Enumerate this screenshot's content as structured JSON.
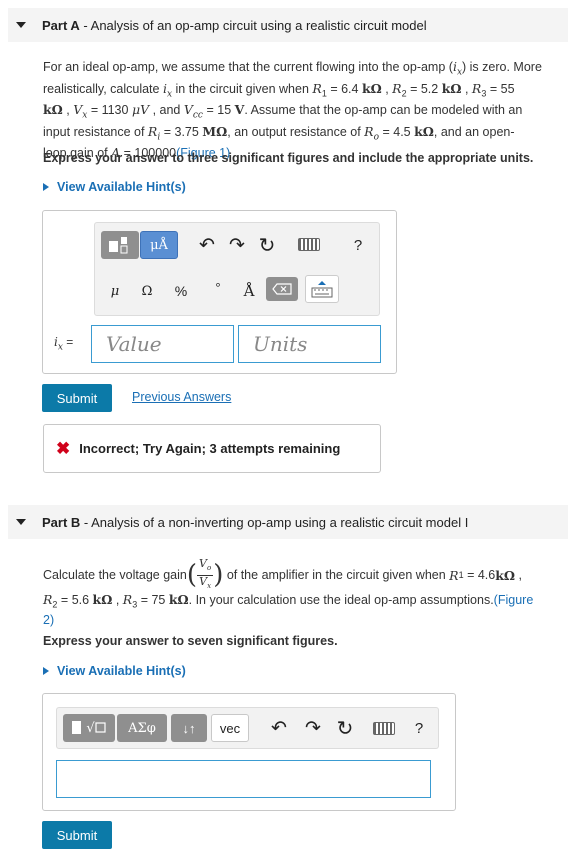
{
  "partA": {
    "label": "Part A",
    "title": " - Analysis of an op-amp circuit using a realistic circuit model",
    "problem": {
      "l1a": "For an ideal op-amp, we assume that the current flowing into the op-amp (",
      "l1v": "i",
      "l1s": "x",
      "l1b": ") is zero. More",
      "l2a": "realistically, calculate ",
      "l2b": " in the circuit given when ",
      "R1": "= 6.4 ",
      "R2": "= 5.2 ",
      "R3": "= 55",
      "unit_k": "kΩ",
      "l3vx": "= 1130 ",
      "l3uV": "μV",
      "l3vcc": "= 15 ",
      "l3V": "V",
      "l3c": ". Assume that the op-amp can be modeled with an",
      "l4a": "input resistance of ",
      "Ri": "= 3.75 ",
      "MOhm": "MΩ",
      "l4b": ", an output resistance of ",
      "Ro": "= 4.5 ",
      "l4c": ", and an open-",
      "l5a": "loop  gain of ",
      "A": "= 100000",
      "fig": "(Figure 1)"
    },
    "instruction": "Express your answer to three significant figures and include the appropriate units.",
    "hint": "View Available Hint(s)",
    "toolbar": {
      "units_btn": "μÅ",
      "undo": "↶",
      "redo": "↷",
      "reset": "↻",
      "help": "?",
      "mu": "μ",
      "omega": "Ω",
      "percent": "%",
      "degree": "°",
      "angstrom": "Å"
    },
    "var_label": "i",
    "var_sub": "x",
    "eq": "=",
    "value_placeholder": "Value",
    "units_placeholder": "Units",
    "submit": "Submit",
    "previous": "Previous Answers",
    "feedback": "Incorrect; Try Again; 3 attempts remaining"
  },
  "partB": {
    "label": "Part B",
    "title": " - Analysis of a non-inverting op-amp using a realistic circuit model I",
    "problem": {
      "l1a": "Calculate the voltage gain ",
      "frac_num": "V",
      "frac_num_sub": "o",
      "frac_den": "V",
      "frac_den_sub": "x",
      "l1b": " of the amplifier in the circuit given when ",
      "R1": "= 4.6 ",
      "R2": "= 5.6 ",
      "R3": "= 75 ",
      "unit_k": "kΩ",
      "l2c": ".  In your calculation use the ideal op-amp assumptions.",
      "fig_a": "(Figure",
      "fig_b": "2)"
    },
    "instruction": "Express your answer to seven significant figures.",
    "hint": "View Available Hint(s)",
    "toolbar": {
      "sqrt_btn": "√",
      "greek_btn": "ΑΣφ",
      "sort_btn": "↓↑",
      "vec_btn": "vec",
      "undo": "↶",
      "redo": "↷",
      "reset": "↻",
      "help": "?"
    },
    "submit": "Submit"
  }
}
